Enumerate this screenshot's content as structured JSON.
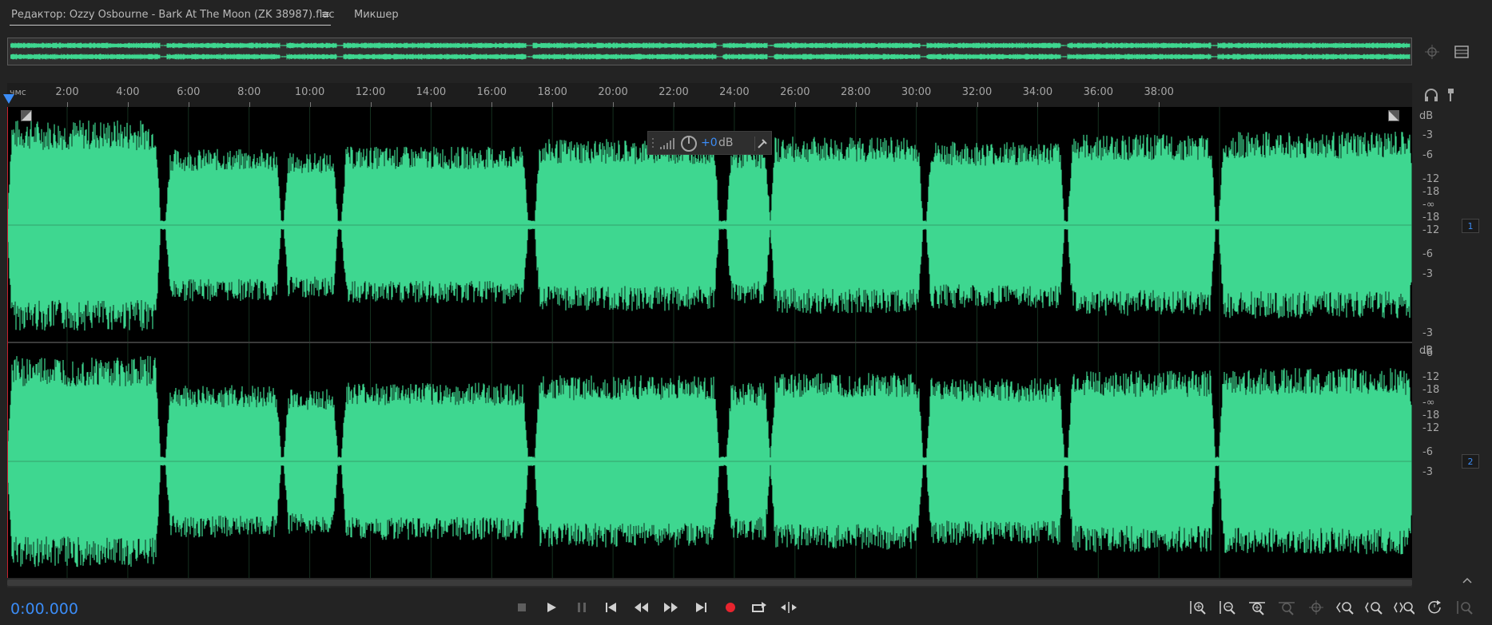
{
  "tabs": {
    "editor_label": "Редактор: Ozzy Osbourne - Bark At The Moon (ZK 38987).flac",
    "menu_glyph": "≡",
    "mixer_label": "Микшер"
  },
  "ruler": {
    "unit": "чмс",
    "ticks": [
      "2:00",
      "4:00",
      "6:00",
      "8:00",
      "10:00",
      "12:00",
      "14:00",
      "16:00",
      "18:00",
      "20:00",
      "22:00",
      "24:00",
      "26:00",
      "28:00",
      "30:00",
      "32:00",
      "34:00",
      "36:00",
      "38:00"
    ]
  },
  "hud": {
    "value": "+0",
    "unit": "dB"
  },
  "db_scale": {
    "header": "dB",
    "labels": [
      "-3",
      "-6",
      "-12",
      "-18",
      "-∞",
      "-18",
      "-12",
      "-6",
      "-3"
    ]
  },
  "channels": [
    "1",
    "2"
  ],
  "time_display": "0:00.000",
  "colors": {
    "waveform": "#3ed790",
    "accent": "#3b8cf6",
    "record": "#e8242e",
    "playhead": "#c8222e"
  },
  "icons": {
    "transport": [
      "stop-icon",
      "play-icon",
      "pause-icon",
      "go-to-start-icon",
      "rewind-icon",
      "fast-forward-icon",
      "go-to-end-icon",
      "record-icon",
      "loop-icon",
      "skip-selection-icon"
    ],
    "zoom": [
      "zoom-in-amplitude-icon",
      "zoom-out-amplitude-icon",
      "zoom-in-time-icon",
      "zoom-out-full-icon",
      "zoom-in-selection-icon",
      "zoom-out-left-icon",
      "zoom-out-icon",
      "zoom-full-icon",
      "zoom-reset-icon",
      "zoom-settings-icon"
    ]
  }
}
